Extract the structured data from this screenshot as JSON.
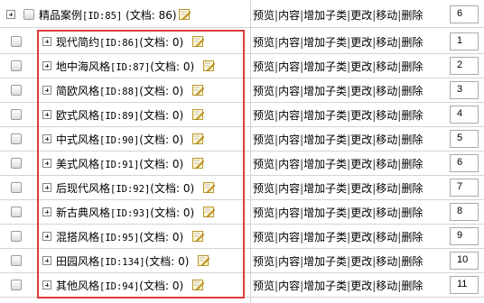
{
  "parent": {
    "name": "精品案例",
    "id_text": "[ID:85]",
    "doc_text": "(文档: 86)",
    "order": "6"
  },
  "actions": {
    "preview": "预览",
    "content": "内容",
    "add_child": "增加子类",
    "edit": "更改",
    "move": "移动",
    "delete": "删除",
    "separator": "|"
  },
  "children": [
    {
      "name": "现代简约",
      "id_text": "[ID:86]",
      "doc_text": "(文档: 0)",
      "order": "1"
    },
    {
      "name": "地中海风格",
      "id_text": "[ID:87]",
      "doc_text": "(文档: 0)",
      "order": "2"
    },
    {
      "name": "简欧风格",
      "id_text": "[ID:88]",
      "doc_text": "(文档: 0)",
      "order": "3"
    },
    {
      "name": "欧式风格",
      "id_text": "[ID:89]",
      "doc_text": "(文档: 0)",
      "order": "4"
    },
    {
      "name": "中式风格",
      "id_text": "[ID:90]",
      "doc_text": "(文档: 0)",
      "order": "5"
    },
    {
      "name": "美式风格",
      "id_text": "[ID:91]",
      "doc_text": "(文档: 0)",
      "order": "6"
    },
    {
      "name": "后现代风格",
      "id_text": "[ID:92]",
      "doc_text": "(文档: 0)",
      "order": "7"
    },
    {
      "name": "新古典风格",
      "id_text": "[ID:93]",
      "doc_text": "(文档: 0)",
      "order": "8"
    },
    {
      "name": "混搭风格",
      "id_text": "[ID:95]",
      "doc_text": "(文档: 0)",
      "order": "9"
    },
    {
      "name": "田园风格",
      "id_text": "[ID:134]",
      "doc_text": "(文档: 0)",
      "order": "10"
    },
    {
      "name": "其他风格",
      "id_text": "[ID:94]",
      "doc_text": "(文档: 0)",
      "order": "11"
    }
  ],
  "colors": {
    "highlight": "#e23a3a",
    "border": "#d4d4d4",
    "edit_icon": "#e8b730"
  },
  "icons": {
    "expand": "plus-box-icon",
    "edit": "pencil-note-icon"
  }
}
